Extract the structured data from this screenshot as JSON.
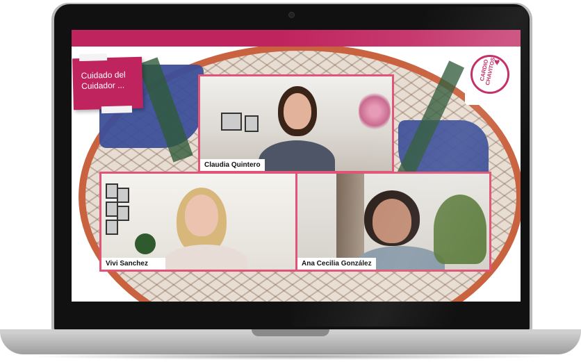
{
  "slide": {
    "title": "Cuidado del\nCuidador ...",
    "logo_text": "CARDIO CHAVITOS"
  },
  "participants": [
    {
      "name": "Claudia Quintero"
    },
    {
      "name": "Vivi Sanchez"
    },
    {
      "name": "Ana Cecilia González"
    }
  ],
  "colors": {
    "brand": "#c0245f",
    "tile_border": "#e05577",
    "laptop_frame": "#111111"
  }
}
